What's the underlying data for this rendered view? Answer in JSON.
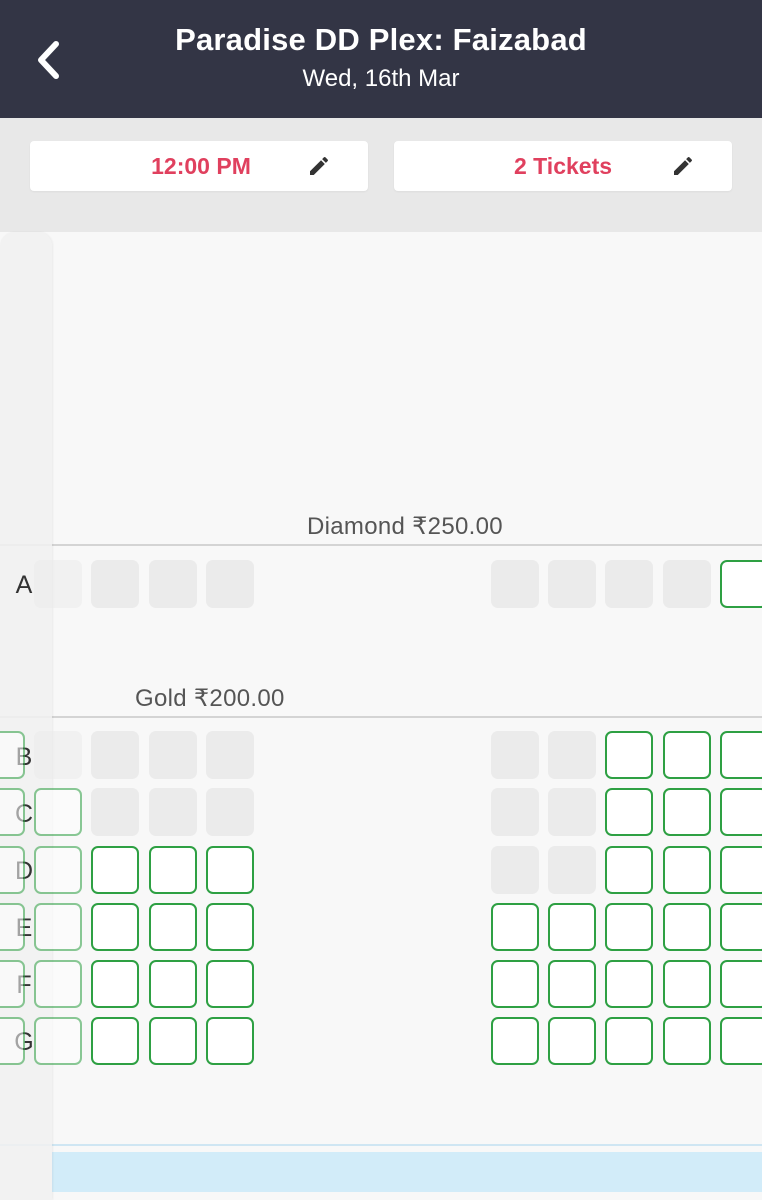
{
  "header": {
    "title": "Paradise DD Plex: Faizabad",
    "date": "Wed, 16th Mar"
  },
  "filters": {
    "time": "12:00 PM",
    "tickets": "2 Tickets"
  },
  "categories": [
    {
      "name": "Diamond ₹250.00",
      "rows": [
        "A"
      ]
    },
    {
      "name": "Gold ₹200.00",
      "rows": [
        "B",
        "C",
        "D",
        "E",
        "F",
        "G"
      ]
    }
  ],
  "seat_status": {
    "A": {
      "left": [
        "sold",
        "sold",
        "sold",
        "sold"
      ],
      "right": [
        "sold",
        "sold",
        "sold",
        "sold",
        "available"
      ]
    },
    "B": {
      "left": [
        "available",
        "sold",
        "sold",
        "sold",
        "sold"
      ],
      "right": [
        "sold",
        "sold",
        "available",
        "available",
        "available"
      ]
    },
    "C": {
      "left": [
        "available",
        "available",
        "sold",
        "sold",
        "sold"
      ],
      "right": [
        "sold",
        "sold",
        "available",
        "available",
        "available"
      ]
    },
    "D": {
      "left": [
        "available",
        "available",
        "available",
        "available",
        "available"
      ],
      "right": [
        "sold",
        "sold",
        "available",
        "available",
        "available"
      ]
    },
    "E": {
      "left": [
        "available",
        "available",
        "available",
        "available",
        "available"
      ],
      "right": [
        "available",
        "available",
        "available",
        "available",
        "available"
      ]
    },
    "F": {
      "left": [
        "available",
        "available",
        "available",
        "available",
        "available"
      ],
      "right": [
        "available",
        "available",
        "available",
        "available",
        "available"
      ]
    },
    "G": {
      "left": [
        "available",
        "available",
        "available",
        "available",
        "available"
      ],
      "right": [
        "available",
        "available",
        "available",
        "available",
        "available"
      ]
    }
  },
  "colors": {
    "header_bg": "#333545",
    "accent": "#e0405e",
    "available_border": "#2ea043",
    "sold": "#ebebeb",
    "screen": "#d2ecf9"
  },
  "icons": {
    "back": "chevron-left-icon",
    "edit": "pencil-icon"
  }
}
